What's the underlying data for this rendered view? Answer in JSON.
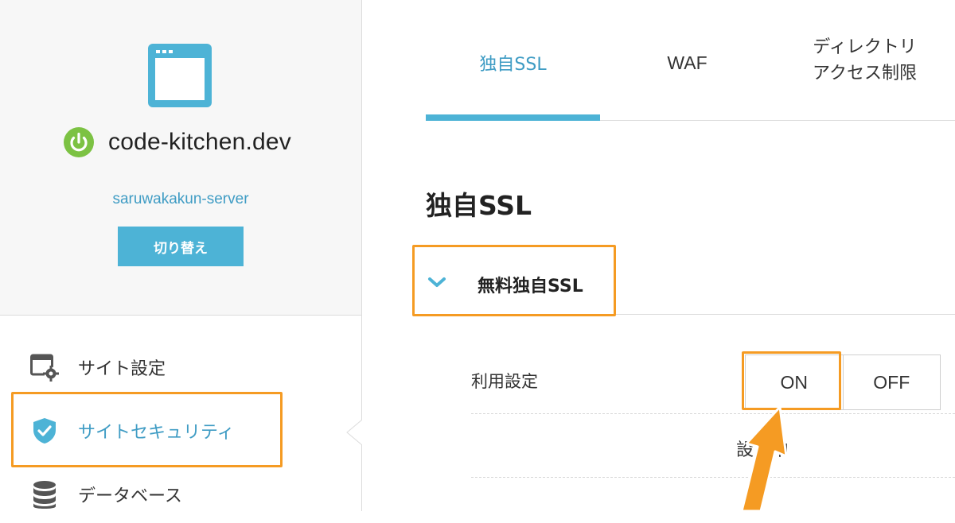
{
  "site": {
    "domain": "code-kitchen.dev",
    "server": "saruwakakun-server",
    "switch_label": "切り替え"
  },
  "sidebar": {
    "items": [
      {
        "label": "サイト設定",
        "icon": "site-settings-icon"
      },
      {
        "label": "サイトセキュリティ",
        "icon": "shield-check-icon",
        "active": true
      },
      {
        "label": "データベース",
        "icon": "database-icon"
      }
    ]
  },
  "tabs": [
    {
      "label": "独自SSL",
      "active": true
    },
    {
      "label": "WAF"
    },
    {
      "label_line1": "ディレクトリ",
      "label_line2": "アクセス制限"
    }
  ],
  "section": {
    "title": "独自SSL",
    "accordion_label": "無料独自SSL"
  },
  "setting": {
    "label": "利用設定",
    "on_label": "ON",
    "off_label": "OFF",
    "status": "設定中"
  },
  "colors": {
    "accent": "#4db3d6",
    "accent_text": "#3f9cc4",
    "highlight": "#f59b23",
    "power_green": "#7cc243"
  }
}
